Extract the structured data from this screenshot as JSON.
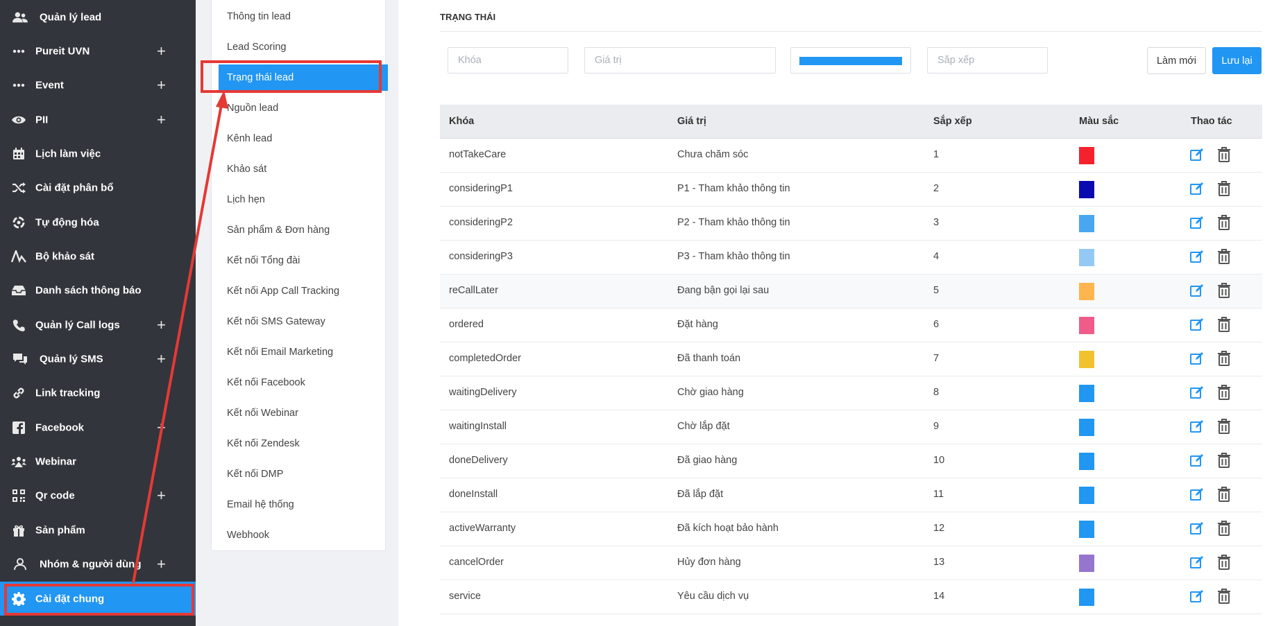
{
  "sidebar": {
    "items": [
      {
        "label": "Quản lý lead",
        "icon": "users-icon",
        "plus": false
      },
      {
        "label": "Pureit UVN",
        "icon": "dots-icon",
        "plus": true
      },
      {
        "label": "Event",
        "icon": "dots-icon",
        "plus": true
      },
      {
        "label": "PII",
        "icon": "eye-icon",
        "plus": true
      },
      {
        "label": "Lịch làm việc",
        "icon": "calendar-icon",
        "plus": false
      },
      {
        "label": "Cài đặt phân bổ",
        "icon": "shuffle-icon",
        "plus": false
      },
      {
        "label": "Tự động hóa",
        "icon": "automation-icon",
        "plus": false
      },
      {
        "label": "Bộ khảo sát",
        "icon": "survey-icon",
        "plus": false
      },
      {
        "label": "Danh sách thông báo",
        "icon": "inbox-icon",
        "plus": false
      },
      {
        "label": "Quản lý Call logs",
        "icon": "phone-icon",
        "plus": true
      },
      {
        "label": "Quản lý SMS",
        "icon": "chat-icon",
        "plus": true
      },
      {
        "label": "Link tracking",
        "icon": "link-icon",
        "plus": false
      },
      {
        "label": "Facebook",
        "icon": "facebook-icon",
        "plus": true
      },
      {
        "label": "Webinar",
        "icon": "webinar-icon",
        "plus": false
      },
      {
        "label": "Qr code",
        "icon": "qrcode-icon",
        "plus": true
      },
      {
        "label": "Sản phẩm",
        "icon": "gift-icon",
        "plus": false
      },
      {
        "label": "Nhóm & người dùng",
        "icon": "user-group-icon",
        "plus": true
      },
      {
        "label": "Cài đặt chung",
        "icon": "gear-icon",
        "plus": false,
        "active": true
      }
    ],
    "plus_symbol": "+"
  },
  "submenu": {
    "items": [
      "Thông tin lead",
      "Lead Scoring",
      "Trạng thái lead",
      "Nguồn lead",
      "Kênh lead",
      "Khảo sát",
      "Lịch hẹn",
      "Sản phẩm & Đơn hàng",
      "Kết nối Tổng đài",
      "Kết nối App Call Tracking",
      "Kết nối SMS Gateway",
      "Kết nối Email Marketing",
      "Kết nối Facebook",
      "Kết nối Webinar",
      "Kết nối Zendesk",
      "Kết nối DMP",
      "Email hệ thống",
      "Webhook"
    ],
    "active_index": 2
  },
  "main": {
    "section_title": "TRẠNG THÁI",
    "form": {
      "key_placeholder": "Khóa",
      "value_placeholder": "Giá trị",
      "color_value": "#2196f3",
      "sort_placeholder": "Sắp xếp",
      "new_label": "Làm mới",
      "save_label": "Lưu lại"
    },
    "table": {
      "headers": [
        "Khóa",
        "Giá trị",
        "Sắp xếp",
        "Màu sắc",
        "Thao tác"
      ],
      "rows": [
        {
          "key": "notTakeCare",
          "value": "Chưa chăm sóc",
          "sort": "1",
          "color": "#f5222d"
        },
        {
          "key": "consideringP1",
          "value": "P1 - Tham khảo thông tin",
          "sort": "2",
          "color": "#0a0ab0"
        },
        {
          "key": "consideringP2",
          "value": "P2 - Tham khảo thông tin",
          "sort": "3",
          "color": "#48a7f0"
        },
        {
          "key": "consideringP3",
          "value": "P3 - Tham khảo thông tin",
          "sort": "4",
          "color": "#94c9f5"
        },
        {
          "key": "reCallLater",
          "value": "Đang bận gọi lại sau",
          "sort": "5",
          "color": "#ffb54d"
        },
        {
          "key": "ordered",
          "value": "Đặt hàng",
          "sort": "6",
          "color": "#ef5c8a"
        },
        {
          "key": "completedOrder",
          "value": "Đã thanh toán",
          "sort": "7",
          "color": "#f2c12e"
        },
        {
          "key": "waitingDelivery",
          "value": "Chờ giao hàng",
          "sort": "8",
          "color": "#2196f3"
        },
        {
          "key": "waitingInstall",
          "value": "Chờ lắp đặt",
          "sort": "9",
          "color": "#2196f3"
        },
        {
          "key": "doneDelivery",
          "value": "Đã giao hàng",
          "sort": "10",
          "color": "#2196f3"
        },
        {
          "key": "doneInstall",
          "value": "Đã lắp đặt",
          "sort": "11",
          "color": "#2196f3"
        },
        {
          "key": "activeWarranty",
          "value": "Đã kích hoạt bảo hành",
          "sort": "12",
          "color": "#2196f3"
        },
        {
          "key": "cancelOrder",
          "value": "Hủy đơn hàng",
          "sort": "13",
          "color": "#9575cd"
        },
        {
          "key": "service",
          "value": "Yêu cầu dịch vụ",
          "sort": "14",
          "color": "#2196f3"
        }
      ]
    }
  },
  "colors": {
    "accent": "#2196f3",
    "sidebar_bg": "#32353b",
    "annotation": "#e53935"
  }
}
